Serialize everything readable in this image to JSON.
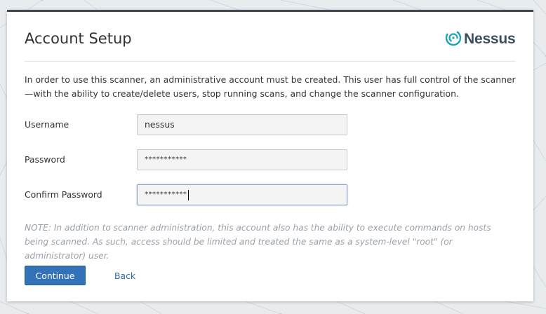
{
  "header": {
    "title": "Account Setup",
    "logo_text": "Nessus"
  },
  "intro_text": "In order to use this scanner, an administrative account must be created. This user has full control of the scanner—with the ability to create/delete users, stop running scans, and change the scanner configuration.",
  "form": {
    "username": {
      "label": "Username",
      "value": "nessus"
    },
    "password": {
      "label": "Password",
      "masked_value": "***********"
    },
    "confirm_password": {
      "label": "Confirm Password",
      "masked_value": "***********"
    }
  },
  "note": "NOTE: In addition to scanner administration, this account also has the ability to execute commands on hosts being scanned. As such, access should be limited and treated the same as a system-level \"root\" (or administrator) user.",
  "actions": {
    "continue_label": "Continue",
    "back_label": "Back"
  },
  "colors": {
    "primary": "#3472b8",
    "link": "#2c6aa8",
    "logo_teal": "#19a5b6",
    "logo_text": "#3a4f5f",
    "card_top_border": "#3f4a55"
  },
  "icons": {
    "logo": "nessus-logo-icon"
  }
}
